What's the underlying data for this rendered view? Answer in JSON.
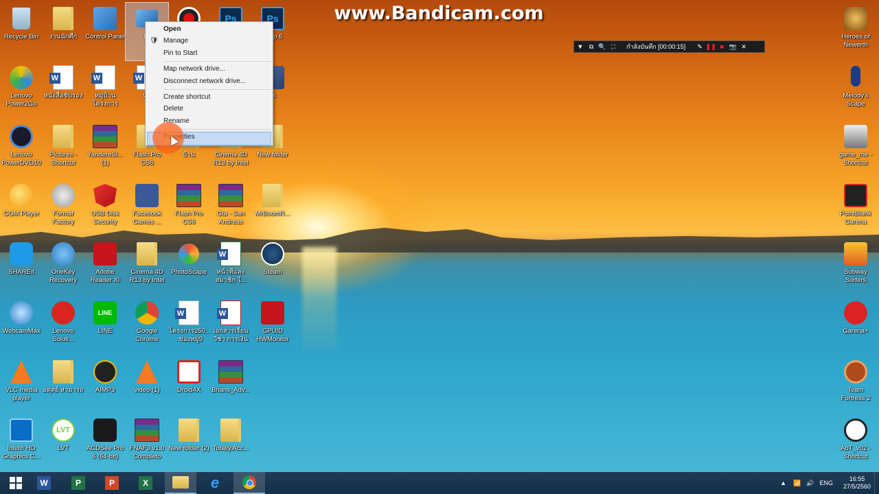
{
  "watermark": "www.Bandicam.com",
  "recording": {
    "text": "กำลังบันทึก [00:00:15]"
  },
  "context_menu": {
    "items": [
      "Open",
      "Manage",
      "Pin to Start",
      "Map network drive...",
      "Disconnect network drive...",
      "Create shortcut",
      "Delete",
      "Rename",
      "Properties"
    ],
    "highlighted": "Properties"
  },
  "desktop_icons": [
    {
      "label": "Recycle Bin",
      "icon": "recycle-bin-icon"
    },
    {
      "label": "งานนักศึก",
      "icon": "folder-icon"
    },
    {
      "label": "Control Panel",
      "icon": "control-panel-icon"
    },
    {
      "label": "Thi",
      "icon": "this-pc-icon"
    },
    {
      "label": "",
      "icon": "bandicam-icon"
    },
    {
      "label": "",
      "icon": "photoshop-icon"
    },
    {
      "label": "shop\n6",
      "icon": "photoshop-icon"
    },
    {
      "label": "Lenovo Power2Go",
      "icon": "power2go-icon"
    },
    {
      "label": "หนังสือขับรอง",
      "icon": "word-doc-icon"
    },
    {
      "label": "หมู่บ้านโครงการ ทหม.60",
      "icon": "word-doc-icon"
    },
    {
      "label": "หมู่",
      "icon": "word-doc-icon"
    },
    {
      "label": "ps",
      "icon": "app-icon"
    },
    {
      "label": "Lenovo PowerDVD10",
      "icon": "powerdvd-icon"
    },
    {
      "label": "Pictures - Shortcut",
      "icon": "folder-icon"
    },
    {
      "label": "YandereSi... (1)",
      "icon": "winrar-icon"
    },
    {
      "label": "Flash Pro CS6",
      "icon": "folder-icon"
    },
    {
      "label": "บ้าน",
      "icon": "folder-icon"
    },
    {
      "label": "Cinema 4D R13 by Intel",
      "icon": "folder-icon"
    },
    {
      "label": "New folder",
      "icon": "folder-icon"
    },
    {
      "label": "GOM Player",
      "icon": "gom-player-icon"
    },
    {
      "label": "Format Factory",
      "icon": "format-factory-icon"
    },
    {
      "label": "USB Disk Security",
      "icon": "usb-security-icon"
    },
    {
      "label": "Facebook Games ...",
      "icon": "facebook-games-icon"
    },
    {
      "label": "Flash Pro CS6",
      "icon": "winrar-icon"
    },
    {
      "label": "Gta - San Andreas",
      "icon": "winrar-icon"
    },
    {
      "label": "MrBoomR...",
      "icon": "folder-icon"
    },
    {
      "label": "SHAREit",
      "icon": "shareit-icon"
    },
    {
      "label": "OneKey Recovery",
      "icon": "onekey-icon"
    },
    {
      "label": "Adobe Reader XI",
      "icon": "adobe-reader-icon"
    },
    {
      "label": "Cinema 4D R13 by Intel",
      "icon": "folder-icon"
    },
    {
      "label": "PhotoScape",
      "icon": "photoscape-icon"
    },
    {
      "label": "หน้าที่และ สมาชิก ใ...",
      "icon": "excel-doc-icon"
    },
    {
      "label": "Steam",
      "icon": "steam-icon"
    },
    {
      "label": "WebcamMax",
      "icon": "webcammax-icon"
    },
    {
      "label": "Lenovo Soluti...",
      "icon": "lenovo-solutions-icon"
    },
    {
      "label": "LINE",
      "icon": "line-icon"
    },
    {
      "label": "Google Chrome",
      "icon": "chrome-icon"
    },
    {
      "label": "โครงการ250... ของหมู่9",
      "icon": "word-doc-icon"
    },
    {
      "label": "เอกสารเรียนวิชา การเงินการ...",
      "icon": "pdf-icon"
    },
    {
      "label": "GPUID HWMonitor",
      "icon": "hwmonitor-icon"
    },
    {
      "label": "VLC media player",
      "icon": "vlc-icon"
    },
    {
      "label": "อดุลย์ สามารถ",
      "icon": "folder-icon"
    },
    {
      "label": "AIMP3",
      "icon": "aimp-icon"
    },
    {
      "label": "video (1)",
      "icon": "vlc-icon"
    },
    {
      "label": "Droid4X",
      "icon": "droid4x-icon"
    },
    {
      "label": "Brians_Adv...",
      "icon": "winrar-icon"
    },
    {
      "label": "Intel® HD Graphics C...",
      "icon": "intel-hd-icon"
    },
    {
      "label": "LVT",
      "icon": "lvt-icon"
    },
    {
      "label": "ACDSee Pro 6 (64-bit)",
      "icon": "acdsee-icon"
    },
    {
      "label": "FNAF3 v1.0 Completo",
      "icon": "winrar-icon"
    },
    {
      "label": "New folder (2)",
      "icon": "folder-icon"
    },
    {
      "label": "Totally.Acc...",
      "icon": "folder-icon"
    },
    {
      "label": "Heroes of Newerth",
      "icon": "hon-icon"
    },
    {
      "label": "Melody's Scape",
      "icon": "melody-icon"
    },
    {
      "label": "game_me - Shortcut",
      "icon": "game-icon"
    },
    {
      "label": "PointBlank Garena",
      "icon": "pointblank-icon"
    },
    {
      "label": "Subway Surfers",
      "icon": "subway-icon"
    },
    {
      "label": "Garena+",
      "icon": "garena-icon"
    },
    {
      "label": "Team Fortress 2",
      "icon": "tf2-icon"
    },
    {
      "label": "AoT_v02 - Shortcut",
      "icon": "unreal-icon"
    }
  ],
  "taskbar": {
    "apps": [
      "start-icon",
      "word-icon",
      "project-icon",
      "powerpoint-icon",
      "excel-icon",
      "file-explorer-icon",
      "internet-explorer-icon",
      "chrome-icon"
    ],
    "lang": "ENG",
    "time": "16:55",
    "date": "27/5/2560"
  }
}
